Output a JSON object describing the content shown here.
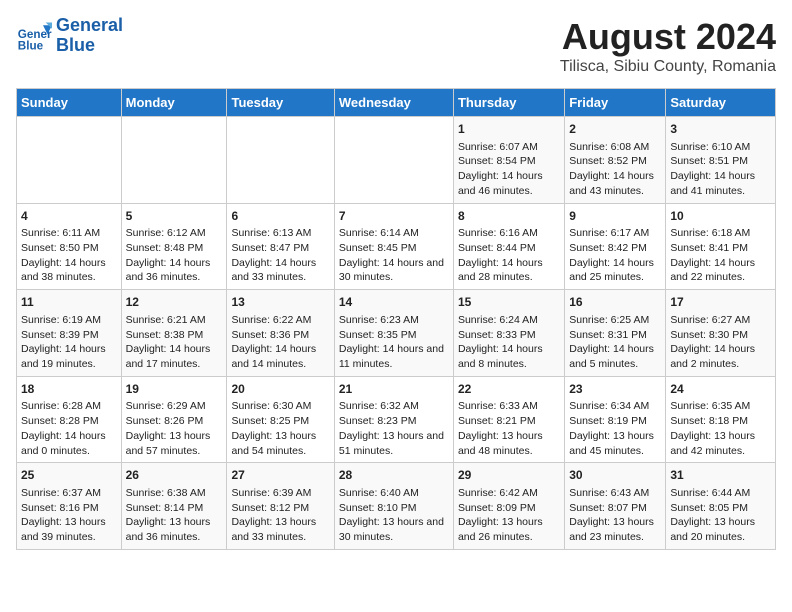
{
  "header": {
    "logo_line1": "General",
    "logo_line2": "Blue",
    "title": "August 2024",
    "subtitle": "Tilisca, Sibiu County, Romania"
  },
  "weekdays": [
    "Sunday",
    "Monday",
    "Tuesday",
    "Wednesday",
    "Thursday",
    "Friday",
    "Saturday"
  ],
  "weeks": [
    [
      {
        "day": "",
        "info": ""
      },
      {
        "day": "",
        "info": ""
      },
      {
        "day": "",
        "info": ""
      },
      {
        "day": "",
        "info": ""
      },
      {
        "day": "1",
        "info": "Sunrise: 6:07 AM\nSunset: 8:54 PM\nDaylight: 14 hours and 46 minutes."
      },
      {
        "day": "2",
        "info": "Sunrise: 6:08 AM\nSunset: 8:52 PM\nDaylight: 14 hours and 43 minutes."
      },
      {
        "day": "3",
        "info": "Sunrise: 6:10 AM\nSunset: 8:51 PM\nDaylight: 14 hours and 41 minutes."
      }
    ],
    [
      {
        "day": "4",
        "info": "Sunrise: 6:11 AM\nSunset: 8:50 PM\nDaylight: 14 hours and 38 minutes."
      },
      {
        "day": "5",
        "info": "Sunrise: 6:12 AM\nSunset: 8:48 PM\nDaylight: 14 hours and 36 minutes."
      },
      {
        "day": "6",
        "info": "Sunrise: 6:13 AM\nSunset: 8:47 PM\nDaylight: 14 hours and 33 minutes."
      },
      {
        "day": "7",
        "info": "Sunrise: 6:14 AM\nSunset: 8:45 PM\nDaylight: 14 hours and 30 minutes."
      },
      {
        "day": "8",
        "info": "Sunrise: 6:16 AM\nSunset: 8:44 PM\nDaylight: 14 hours and 28 minutes."
      },
      {
        "day": "9",
        "info": "Sunrise: 6:17 AM\nSunset: 8:42 PM\nDaylight: 14 hours and 25 minutes."
      },
      {
        "day": "10",
        "info": "Sunrise: 6:18 AM\nSunset: 8:41 PM\nDaylight: 14 hours and 22 minutes."
      }
    ],
    [
      {
        "day": "11",
        "info": "Sunrise: 6:19 AM\nSunset: 8:39 PM\nDaylight: 14 hours and 19 minutes."
      },
      {
        "day": "12",
        "info": "Sunrise: 6:21 AM\nSunset: 8:38 PM\nDaylight: 14 hours and 17 minutes."
      },
      {
        "day": "13",
        "info": "Sunrise: 6:22 AM\nSunset: 8:36 PM\nDaylight: 14 hours and 14 minutes."
      },
      {
        "day": "14",
        "info": "Sunrise: 6:23 AM\nSunset: 8:35 PM\nDaylight: 14 hours and 11 minutes."
      },
      {
        "day": "15",
        "info": "Sunrise: 6:24 AM\nSunset: 8:33 PM\nDaylight: 14 hours and 8 minutes."
      },
      {
        "day": "16",
        "info": "Sunrise: 6:25 AM\nSunset: 8:31 PM\nDaylight: 14 hours and 5 minutes."
      },
      {
        "day": "17",
        "info": "Sunrise: 6:27 AM\nSunset: 8:30 PM\nDaylight: 14 hours and 2 minutes."
      }
    ],
    [
      {
        "day": "18",
        "info": "Sunrise: 6:28 AM\nSunset: 8:28 PM\nDaylight: 14 hours and 0 minutes."
      },
      {
        "day": "19",
        "info": "Sunrise: 6:29 AM\nSunset: 8:26 PM\nDaylight: 13 hours and 57 minutes."
      },
      {
        "day": "20",
        "info": "Sunrise: 6:30 AM\nSunset: 8:25 PM\nDaylight: 13 hours and 54 minutes."
      },
      {
        "day": "21",
        "info": "Sunrise: 6:32 AM\nSunset: 8:23 PM\nDaylight: 13 hours and 51 minutes."
      },
      {
        "day": "22",
        "info": "Sunrise: 6:33 AM\nSunset: 8:21 PM\nDaylight: 13 hours and 48 minutes."
      },
      {
        "day": "23",
        "info": "Sunrise: 6:34 AM\nSunset: 8:19 PM\nDaylight: 13 hours and 45 minutes."
      },
      {
        "day": "24",
        "info": "Sunrise: 6:35 AM\nSunset: 8:18 PM\nDaylight: 13 hours and 42 minutes."
      }
    ],
    [
      {
        "day": "25",
        "info": "Sunrise: 6:37 AM\nSunset: 8:16 PM\nDaylight: 13 hours and 39 minutes."
      },
      {
        "day": "26",
        "info": "Sunrise: 6:38 AM\nSunset: 8:14 PM\nDaylight: 13 hours and 36 minutes."
      },
      {
        "day": "27",
        "info": "Sunrise: 6:39 AM\nSunset: 8:12 PM\nDaylight: 13 hours and 33 minutes."
      },
      {
        "day": "28",
        "info": "Sunrise: 6:40 AM\nSunset: 8:10 PM\nDaylight: 13 hours and 30 minutes."
      },
      {
        "day": "29",
        "info": "Sunrise: 6:42 AM\nSunset: 8:09 PM\nDaylight: 13 hours and 26 minutes."
      },
      {
        "day": "30",
        "info": "Sunrise: 6:43 AM\nSunset: 8:07 PM\nDaylight: 13 hours and 23 minutes."
      },
      {
        "day": "31",
        "info": "Sunrise: 6:44 AM\nSunset: 8:05 PM\nDaylight: 13 hours and 20 minutes."
      }
    ]
  ]
}
